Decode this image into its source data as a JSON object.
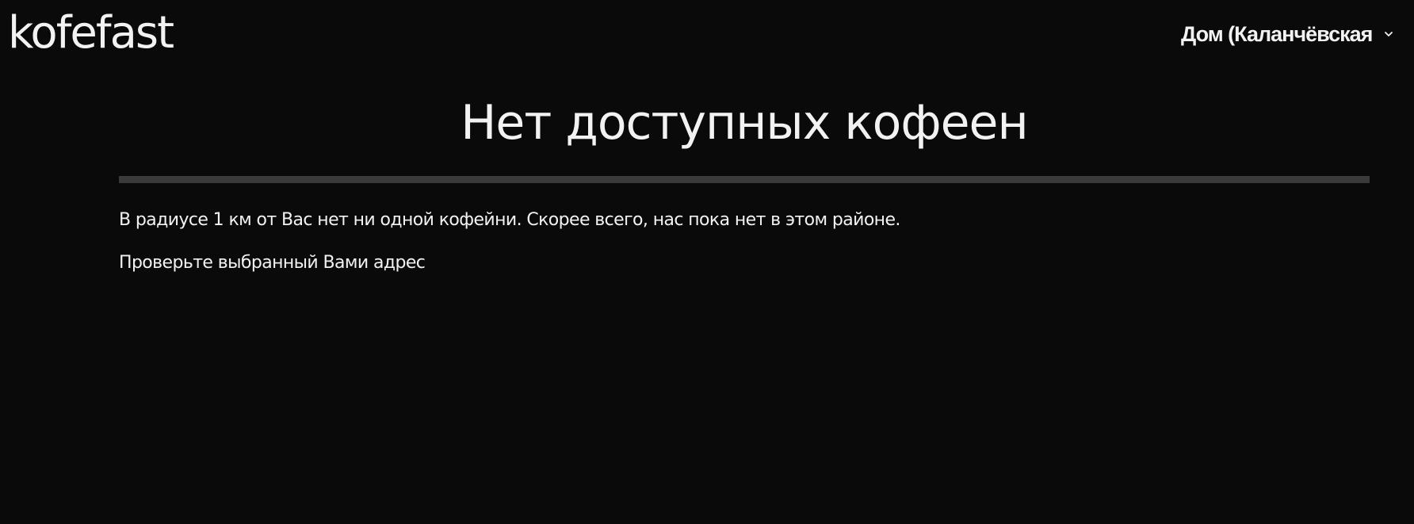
{
  "header": {
    "logo": "kofefast",
    "address": {
      "label": "Дом (Каланчёвская",
      "icon": "chevron-down-icon"
    }
  },
  "main": {
    "title": "Нет доступных кофеен",
    "message": "В радиусе 1 км от Вас нет ни одной кофейни. Скорее всего, нас пока нет в этом районе.",
    "hint": "Проверьте выбранный Вами адрес"
  },
  "colors": {
    "background": "#0a0a0a",
    "text": "#f2f2f2",
    "divider": "#3a3a3a"
  }
}
